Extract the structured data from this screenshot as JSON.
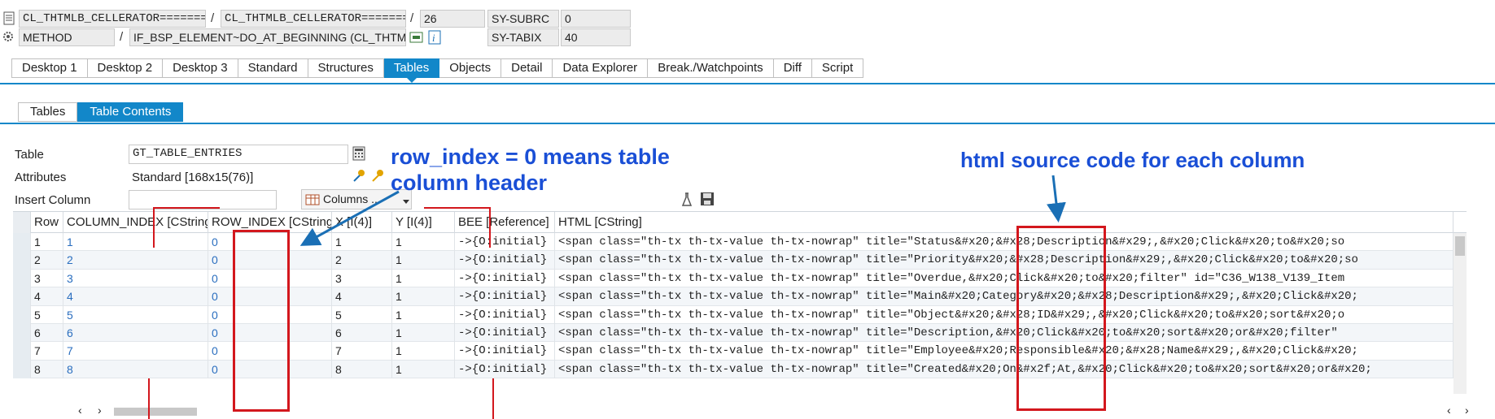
{
  "header": {
    "class_field": "CL_THTMLB_CELLERATOR==========…",
    "class_field2": "CL_THTMLB_CELLERATOR=========…",
    "line_no": "26",
    "sy_subrc_label": "SY-SUBRC",
    "sy_subrc_value": "0",
    "method_type": "METHOD",
    "method_name": "IF_BSP_ELEMENT~DO_AT_BEGINNING (CL_THTMLB_C…",
    "sy_tabix_label": "SY-TABIX",
    "sy_tabix_value": "40",
    "slash": "/"
  },
  "tabs": [
    "Desktop 1",
    "Desktop 2",
    "Desktop 3",
    "Standard",
    "Structures",
    "Tables",
    "Objects",
    "Detail",
    "Data Explorer",
    "Break./Watchpoints",
    "Diff",
    "Script"
  ],
  "active_tab": "Tables",
  "subtabs": [
    "Tables",
    "Table Contents"
  ],
  "active_subtab": "Table Contents",
  "form": {
    "table_label": "Table",
    "table_value": "GT_TABLE_ENTRIES",
    "attributes_label": "Attributes",
    "attributes_value": "Standard [168x15(76)]",
    "insert_column_label": "Insert Column",
    "insert_column_value": "",
    "columns_button": "Columns ..."
  },
  "table": {
    "columns": [
      "Row",
      "COLUMN_INDEX [CString]",
      "ROW_INDEX [CString]",
      "X [I(4)]",
      "Y [I(4)]",
      "BEE [Reference]",
      "HTML [CString]"
    ],
    "rows": [
      [
        "1",
        "1",
        "0",
        "1",
        "1",
        "->{O:initial}",
        "<span class=\"th-tx th-tx-value th-tx-nowrap\"  title=\"Status&#x20;&#x28;Description&#x29;,&#x20;Click&#x20;to&#x20;so"
      ],
      [
        "2",
        "2",
        "0",
        "2",
        "1",
        "->{O:initial}",
        "<span class=\"th-tx th-tx-value th-tx-nowrap\"  title=\"Priority&#x20;&#x28;Description&#x29;,&#x20;Click&#x20;to&#x20;so"
      ],
      [
        "3",
        "3",
        "0",
        "3",
        "1",
        "->{O:initial}",
        "<span class=\"th-tx th-tx-value th-tx-nowrap\"  title=\"Overdue,&#x20;Click&#x20;to&#x20;filter\" id=\"C36_W138_V139_Item"
      ],
      [
        "4",
        "4",
        "0",
        "4",
        "1",
        "->{O:initial}",
        "<span class=\"th-tx th-tx-value th-tx-nowrap\"  title=\"Main&#x20;Category&#x20;&#x28;Description&#x29;,&#x20;Click&#x20;"
      ],
      [
        "5",
        "5",
        "0",
        "5",
        "1",
        "->{O:initial}",
        "<span class=\"th-tx th-tx-value th-tx-nowrap\"  title=\"Object&#x20;&#x28;ID&#x29;,&#x20;Click&#x20;to&#x20;sort&#x20;o"
      ],
      [
        "6",
        "6",
        "0",
        "6",
        "1",
        "->{O:initial}",
        "<span class=\"th-tx th-tx-value th-tx-nowrap\"  title=\"Description,&#x20;Click&#x20;to&#x20;sort&#x20;or&#x20;filter\""
      ],
      [
        "7",
        "7",
        "0",
        "7",
        "1",
        "->{O:initial}",
        "<span class=\"th-tx th-tx-value th-tx-nowrap\"  title=\"Employee&#x20;Responsible&#x20;&#x28;Name&#x29;,&#x20;Click&#x20;"
      ],
      [
        "8",
        "8",
        "0",
        "8",
        "1",
        "->{O:initial}",
        "<span class=\"th-tx th-tx-value th-tx-nowrap\"  title=\"Created&#x20;On&#x2f;At,&#x20;Click&#x20;to&#x20;sort&#x20;or&#x20;"
      ]
    ]
  },
  "annotations": {
    "row_index_note_line1": "row_index = 0 means table",
    "row_index_note_line2": "column header",
    "html_note": "html source code for each column"
  },
  "colors": {
    "accent": "#1287c9",
    "annotation": "#1a4fd6",
    "highlight_box": "#d3171d",
    "link": "#2a6ebf"
  },
  "icons": [
    "document-icon",
    "settings-gear-icon",
    "edit-icon",
    "info-icon",
    "calculator-icon",
    "key-icon",
    "columns-table-icon",
    "dropdown-arrow-icon",
    "flask-icon",
    "save-icon",
    "scroll-left-icon",
    "scroll-right-icon"
  ]
}
